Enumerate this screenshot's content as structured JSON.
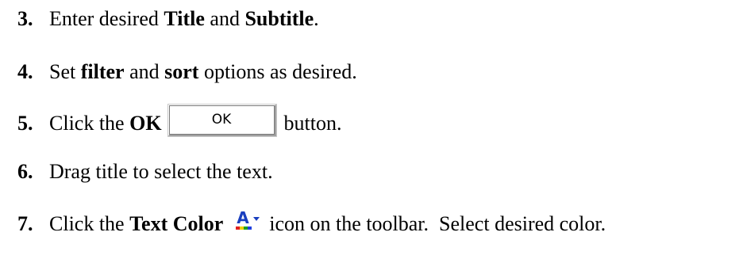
{
  "steps": [
    {
      "num": "3.",
      "t1": "Enter desired ",
      "b1": "Title",
      "t2": " and ",
      "b2": "Subtitle",
      "t3": "."
    },
    {
      "num": "4.",
      "t1": "Set ",
      "b1": "filter",
      "t2": " and ",
      "b2": "sort",
      "t3": " options as desired."
    },
    {
      "num": "5.",
      "t1": "Click the ",
      "b1": "OK",
      "button_label": "OK",
      "t2": "button."
    },
    {
      "num": "6.",
      "t1": "Drag title to select the text."
    },
    {
      "num": "7.",
      "t1": "Click the ",
      "b1": "Text Color",
      "icon": "text-color-icon",
      "t2": "icon on the toolbar.  Select desired color.",
      "icon_colors": {
        "letter": "#1a3fbf",
        "bar": [
          "#e02020",
          "#f0d000",
          "#20a020",
          "#2040e0"
        ]
      }
    }
  ]
}
